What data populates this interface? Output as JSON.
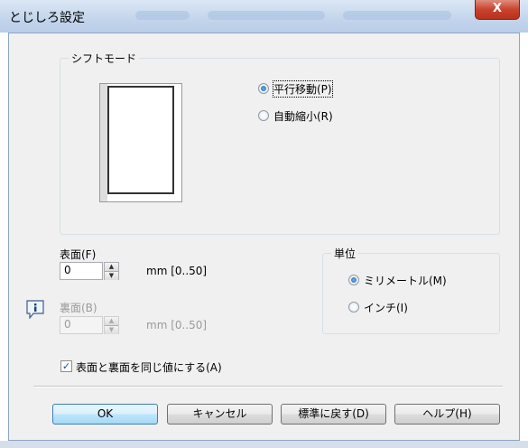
{
  "window": {
    "title": "とじしろ設定",
    "close_glyph": "X"
  },
  "shift_mode": {
    "legend": "シフトモード",
    "options": [
      {
        "label": "平行移動(P)",
        "checked": true
      },
      {
        "label": "自動縮小(R)",
        "checked": false
      }
    ]
  },
  "front": {
    "label": "表面(F)",
    "value": "0",
    "range": "mm [0..50]"
  },
  "back": {
    "label": "裏面(B)",
    "value": "0",
    "range": "mm [0..50]",
    "disabled": true
  },
  "unit": {
    "legend": "単位",
    "options": [
      {
        "label": "ミリメートル(M)",
        "checked": true
      },
      {
        "label": "インチ(I)",
        "checked": false
      }
    ]
  },
  "same_value": {
    "label": "表面と裏面を同じ値にする(A)",
    "checked": true
  },
  "buttons": {
    "ok": "OK",
    "cancel": "キャンセル",
    "reset": "標準に戻す(D)",
    "help": "ヘルプ(H)"
  },
  "colors": {
    "accent": "#1b5fab",
    "titlebar": "#c3d5ec",
    "close": "#c8432d"
  }
}
